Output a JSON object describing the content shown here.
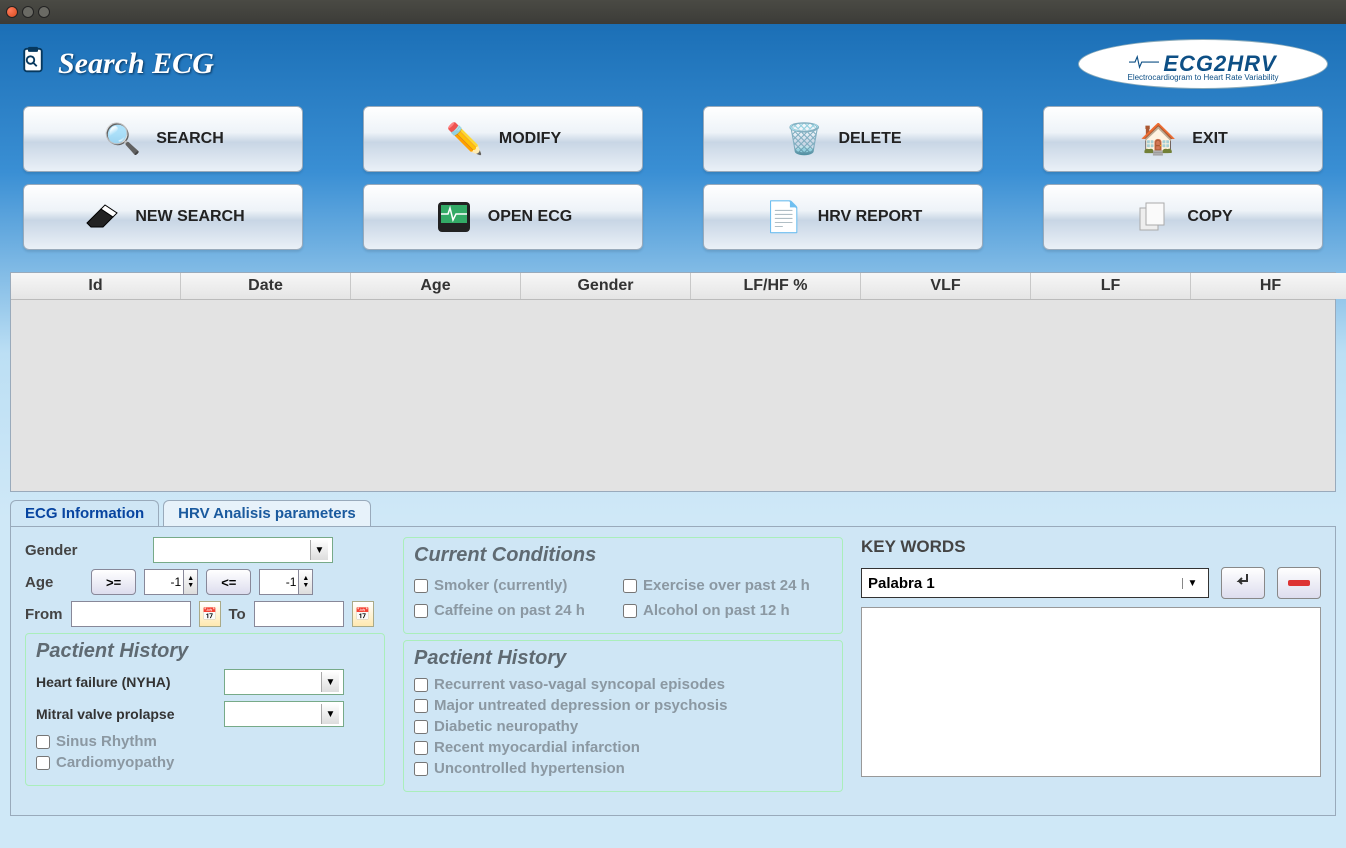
{
  "app": {
    "title": "Search ECG",
    "logo_main": "ECG2HRV",
    "logo_sub": "Electrocardiogram to Heart Rate Variability"
  },
  "toolbar": {
    "search": "SEARCH",
    "modify": "MODIFY",
    "delete": "DELETE",
    "exit": "EXIT",
    "new_search": "NEW SEARCH",
    "open_ecg": "OPEN ECG",
    "hrv_report": "HRV REPORT",
    "copy": "COPY"
  },
  "table": {
    "headers": [
      "Id",
      "Date",
      "Age",
      "Gender",
      "LF/HF %",
      "VLF",
      "LF",
      "HF"
    ]
  },
  "tabs": {
    "t1": "ECG Information",
    "t2": "HRV Analisis parameters"
  },
  "filters": {
    "gender_label": "Gender",
    "gender_value": "",
    "age_label": "Age",
    "ge": ">=",
    "le": "<=",
    "age_min": "-1",
    "age_max": "-1",
    "from_label": "From",
    "to_label": "To",
    "patient_history_title": "Pactient History",
    "hf_label": "Heart failure (NYHA)",
    "hf_value": "",
    "mvp_label": "Mitral valve prolapse",
    "mvp_value": "",
    "sinus": "Sinus Rhythm",
    "cardio": "Cardiomyopathy"
  },
  "conditions": {
    "title": "Current Conditions",
    "smoker": "Smoker (currently)",
    "exercise": "Exercise over past 24 h",
    "caffeine": "Caffeine on past 24 h",
    "alcohol": "Alcohol on past 12 h",
    "history_title": "Pactient History",
    "h1": "Recurrent vaso-vagal syncopal episodes",
    "h2": "Major untreated depression or psychosis",
    "h3": "Diabetic neuropathy",
    "h4": "Recent myocardial infarction",
    "h5": "Uncontrolled hypertension"
  },
  "keywords": {
    "title": "KEY WORDS",
    "selected": "Palabra 1"
  }
}
